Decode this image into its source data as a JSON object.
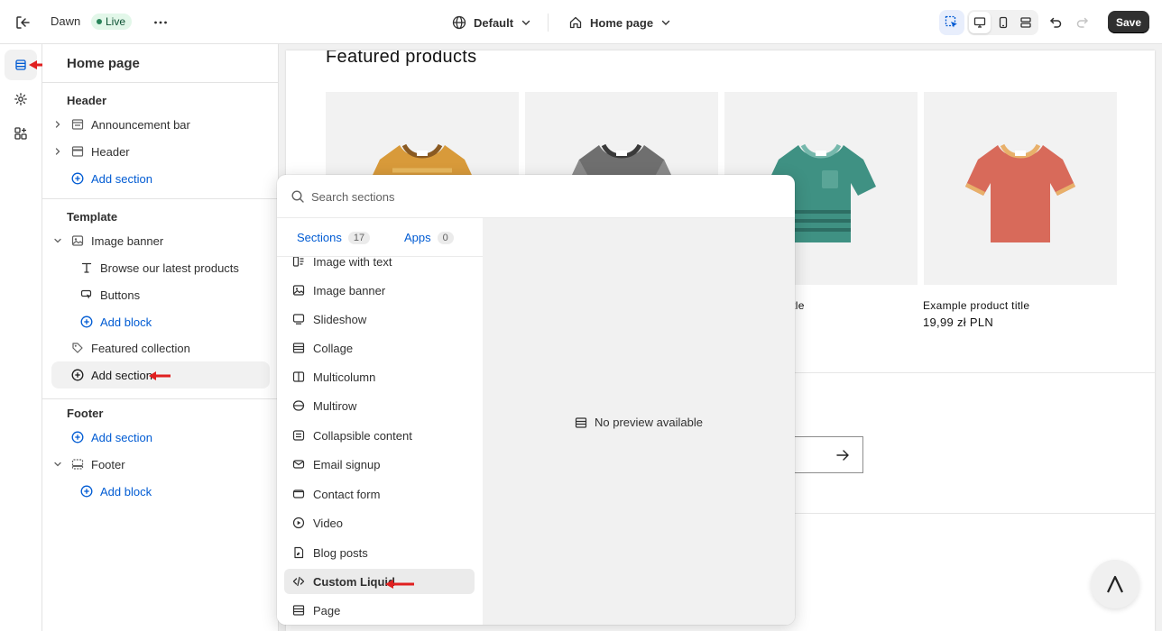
{
  "topbar": {
    "store_name": "Dawn",
    "status_badge": "Live",
    "theme_selector": "Default",
    "page_selector": "Home page",
    "save_label": "Save"
  },
  "sidebar": {
    "title": "Home page",
    "groups": {
      "header": "Header",
      "template": "Template",
      "footer": "Footer"
    },
    "items": {
      "announcement_bar": "Announcement bar",
      "header": "Header",
      "header_add_section": "Add section",
      "image_banner": "Image banner",
      "browse_text": "Browse our latest products",
      "buttons": "Buttons",
      "banner_add_block": "Add block",
      "featured_collection": "Featured collection",
      "template_add_section": "Add section",
      "footer_add_section": "Add section",
      "footer": "Footer",
      "footer_add_block": "Add block"
    }
  },
  "preview": {
    "heading": "Featured products",
    "products": [
      {
        "title": "ct title",
        "price": ""
      },
      {
        "title": "Example product title",
        "price": "19,99 zł PLN"
      }
    ]
  },
  "picker": {
    "search_placeholder": "Search sections",
    "tabs": [
      {
        "label": "Sections",
        "count": "17"
      },
      {
        "label": "Apps",
        "count": "0"
      }
    ],
    "sections": [
      "Image with text",
      "Image banner",
      "Slideshow",
      "Collage",
      "Multicolumn",
      "Multirow",
      "Collapsible content",
      "Email signup",
      "Contact form",
      "Video",
      "Blog posts",
      "Custom Liquid",
      "Page"
    ],
    "no_preview": "No preview available"
  },
  "colors": {
    "accent": "#005bd3",
    "annotation_arrow": "#e02020",
    "tshirt_yellow": "#d89a3a",
    "tshirt_gray": "#6f6f6f",
    "tshirt_teal": "#3f9183",
    "tshirt_coral": "#d86a5a"
  }
}
